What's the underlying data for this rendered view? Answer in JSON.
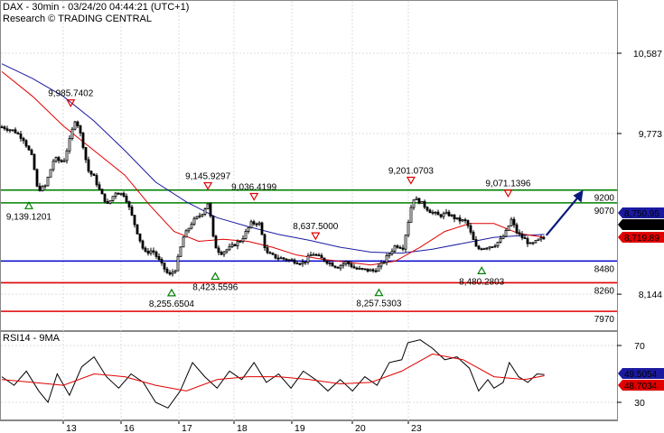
{
  "header": {
    "line1": "DAX - 30min - 03/24/20 04:44:21 (UTC+1)",
    "line2": "Research © TRADING CENTRAL"
  },
  "colors": {
    "price": "#000000",
    "ma_fast": "#e00000",
    "ma_slow": "#1a1aa0",
    "support_resistance": "#008000",
    "pivot": "#0000cc",
    "level_red": "#e00000",
    "arrow": "#0a1a7a",
    "marker_green": "#008000",
    "marker_red": "#e00000",
    "rsi": "#000000",
    "rsi_ma": "#e00000",
    "grid": "#dcdcdc"
  },
  "chart_data": [
    {
      "type": "candlestick",
      "title": "DAX - 30min - 03/24/20 04:44:21 (UTC+1)",
      "x_tick_labels": [
        "13",
        "16",
        "17",
        "18",
        "19",
        "20",
        "23"
      ],
      "y_axis_tick_labels": [
        "10,587",
        "9,773",
        "8,144"
      ],
      "ylim": [
        7850,
        11000
      ],
      "horizontal_levels": [
        {
          "value": 9200,
          "label": "9200",
          "color": "green"
        },
        {
          "value": 9070,
          "label": "9070",
          "color": "green"
        },
        {
          "value": 8480,
          "label": "8480",
          "color": "blue"
        },
        {
          "value": 8260,
          "label": "8260",
          "color": "red"
        },
        {
          "value": 7970,
          "label": "7970",
          "color": "red"
        }
      ],
      "price_tags": [
        {
          "value": 8750.95,
          "label": "8,750.95",
          "style": "blue"
        },
        {
          "value": 8741.15,
          "label": "8,741.15",
          "style": "black"
        },
        {
          "value": 8719.89,
          "label": "8,719.89",
          "style": "red"
        }
      ],
      "annotations": [
        {
          "label": "9,985.7402",
          "kind": "high",
          "x": 0.112,
          "value": 9985.74
        },
        {
          "label": "9,139.1201",
          "kind": "low",
          "x": 0.044,
          "value": 9139.12
        },
        {
          "label": "9,145.9297",
          "kind": "high",
          "x": 0.335,
          "value": 9145.93
        },
        {
          "label": "9,036.4199",
          "kind": "high",
          "x": 0.41,
          "value": 9036.42
        },
        {
          "label": "8,423.5596",
          "kind": "low",
          "x": 0.347,
          "value": 8423.56
        },
        {
          "label": "8,255.6504",
          "kind": "low",
          "x": 0.276,
          "value": 8255.65
        },
        {
          "label": "8,637.5000",
          "kind": "high",
          "x": 0.51,
          "value": 8637.5
        },
        {
          "label": "9,201.0703",
          "kind": "high",
          "x": 0.665,
          "value": 9201.07
        },
        {
          "label": "8,257.5303",
          "kind": "low",
          "x": 0.613,
          "value": 8257.53
        },
        {
          "label": "9,071.1396",
          "kind": "high",
          "x": 0.823,
          "value": 9071.14
        },
        {
          "label": "8,480.2803",
          "kind": "low",
          "x": 0.78,
          "value": 8480.28
        }
      ],
      "close_points": [
        [
          0,
          9840
        ],
        [
          0.02,
          9800
        ],
        [
          0.035,
          9720
        ],
        [
          0.05,
          9520
        ],
        [
          0.058,
          9200
        ],
        [
          0.07,
          9230
        ],
        [
          0.085,
          9520
        ],
        [
          0.1,
          9480
        ],
        [
          0.11,
          9700
        ],
        [
          0.12,
          9935
        ],
        [
          0.13,
          9720
        ],
        [
          0.14,
          9400
        ],
        [
          0.15,
          9330
        ],
        [
          0.16,
          9180
        ],
        [
          0.172,
          9050
        ],
        [
          0.185,
          9180
        ],
        [
          0.2,
          9150
        ],
        [
          0.222,
          8740
        ],
        [
          0.232,
          8560
        ],
        [
          0.245,
          8590
        ],
        [
          0.26,
          8440
        ],
        [
          0.272,
          8330
        ],
        [
          0.282,
          8400
        ],
        [
          0.295,
          8720
        ],
        [
          0.31,
          8880
        ],
        [
          0.325,
          8960
        ],
        [
          0.336,
          9080
        ],
        [
          0.345,
          8650
        ],
        [
          0.355,
          8560
        ],
        [
          0.37,
          8610
        ],
        [
          0.39,
          8700
        ],
        [
          0.405,
          8860
        ],
        [
          0.418,
          8870
        ],
        [
          0.43,
          8560
        ],
        [
          0.445,
          8520
        ],
        [
          0.46,
          8500
        ],
        [
          0.475,
          8480
        ],
        [
          0.49,
          8460
        ],
        [
          0.505,
          8560
        ],
        [
          0.515,
          8520
        ],
        [
          0.53,
          8470
        ],
        [
          0.545,
          8420
        ],
        [
          0.56,
          8470
        ],
        [
          0.575,
          8400
        ],
        [
          0.59,
          8390
        ],
        [
          0.605,
          8380
        ],
        [
          0.618,
          8450
        ],
        [
          0.628,
          8540
        ],
        [
          0.64,
          8640
        ],
        [
          0.652,
          8620
        ],
        [
          0.662,
          8920
        ],
        [
          0.668,
          9120
        ],
        [
          0.68,
          9080
        ],
        [
          0.695,
          8990
        ],
        [
          0.71,
          8940
        ],
        [
          0.725,
          8960
        ],
        [
          0.74,
          8900
        ],
        [
          0.755,
          8880
        ],
        [
          0.772,
          8600
        ],
        [
          0.785,
          8620
        ],
        [
          0.8,
          8640
        ],
        [
          0.812,
          8700
        ],
        [
          0.82,
          8780
        ],
        [
          0.828,
          8900
        ],
        [
          0.838,
          8760
        ],
        [
          0.85,
          8700
        ],
        [
          0.86,
          8640
        ],
        [
          0.872,
          8690
        ],
        [
          0.882,
          8720
        ]
      ],
      "ma_fast_points": [
        [
          0,
          10400
        ],
        [
          0.05,
          10150
        ],
        [
          0.1,
          9850
        ],
        [
          0.15,
          9600
        ],
        [
          0.2,
          9350
        ],
        [
          0.24,
          9050
        ],
        [
          0.28,
          8780
        ],
        [
          0.32,
          8680
        ],
        [
          0.36,
          8700
        ],
        [
          0.4,
          8680
        ],
        [
          0.44,
          8620
        ],
        [
          0.48,
          8540
        ],
        [
          0.52,
          8500
        ],
        [
          0.56,
          8470
        ],
        [
          0.6,
          8440
        ],
        [
          0.64,
          8480
        ],
        [
          0.68,
          8620
        ],
        [
          0.72,
          8780
        ],
        [
          0.76,
          8860
        ],
        [
          0.8,
          8860
        ],
        [
          0.84,
          8760
        ],
        [
          0.882,
          8720
        ]
      ],
      "ma_slow_points": [
        [
          0,
          10480
        ],
        [
          0.05,
          10330
        ],
        [
          0.1,
          10150
        ],
        [
          0.15,
          9900
        ],
        [
          0.2,
          9600
        ],
        [
          0.25,
          9280
        ],
        [
          0.3,
          9080
        ],
        [
          0.35,
          8920
        ],
        [
          0.4,
          8830
        ],
        [
          0.45,
          8750
        ],
        [
          0.5,
          8690
        ],
        [
          0.55,
          8620
        ],
        [
          0.6,
          8570
        ],
        [
          0.65,
          8560
        ],
        [
          0.7,
          8600
        ],
        [
          0.75,
          8660
        ],
        [
          0.8,
          8720
        ],
        [
          0.85,
          8740
        ],
        [
          0.882,
          8750
        ]
      ],
      "projection_arrow": {
        "from": [
          0.885,
          8740
        ],
        "to": [
          0.945,
          9200
        ]
      }
    },
    {
      "type": "line",
      "title": "RSI14 - 9MA",
      "series": [
        {
          "name": "RSI14",
          "color": "black"
        },
        {
          "name": "9MA",
          "color": "red"
        }
      ],
      "y_axis_tick_labels": [
        "70",
        "30"
      ],
      "ylim": [
        15,
        85
      ],
      "value_tags": [
        {
          "value": 49.5054,
          "label": "49.5054",
          "style": "blue"
        },
        {
          "value": 48.7034,
          "label": "48.7034",
          "style": "red"
        }
      ],
      "rsi_points": [
        [
          0,
          48
        ],
        [
          0.02,
          42
        ],
        [
          0.04,
          52
        ],
        [
          0.06,
          38
        ],
        [
          0.075,
          30
        ],
        [
          0.09,
          50
        ],
        [
          0.11,
          35
        ],
        [
          0.13,
          55
        ],
        [
          0.15,
          62
        ],
        [
          0.17,
          48
        ],
        [
          0.19,
          40
        ],
        [
          0.21,
          50
        ],
        [
          0.23,
          44
        ],
        [
          0.25,
          30
        ],
        [
          0.27,
          26
        ],
        [
          0.29,
          38
        ],
        [
          0.31,
          58
        ],
        [
          0.33,
          48
        ],
        [
          0.35,
          40
        ],
        [
          0.37,
          52
        ],
        [
          0.39,
          46
        ],
        [
          0.41,
          58
        ],
        [
          0.43,
          44
        ],
        [
          0.45,
          50
        ],
        [
          0.47,
          40
        ],
        [
          0.49,
          52
        ],
        [
          0.51,
          46
        ],
        [
          0.53,
          38
        ],
        [
          0.55,
          46
        ],
        [
          0.57,
          38
        ],
        [
          0.59,
          48
        ],
        [
          0.61,
          42
        ],
        [
          0.63,
          58
        ],
        [
          0.65,
          60
        ],
        [
          0.66,
          72
        ],
        [
          0.68,
          74
        ],
        [
          0.7,
          68
        ],
        [
          0.72,
          60
        ],
        [
          0.74,
          62
        ],
        [
          0.76,
          54
        ],
        [
          0.775,
          38
        ],
        [
          0.79,
          46
        ],
        [
          0.8,
          40
        ],
        [
          0.815,
          44
        ],
        [
          0.825,
          58
        ],
        [
          0.84,
          48
        ],
        [
          0.855,
          44
        ],
        [
          0.87,
          50
        ],
        [
          0.882,
          49.5
        ]
      ],
      "rsi_ma_points": [
        [
          0,
          46
        ],
        [
          0.05,
          44
        ],
        [
          0.1,
          42
        ],
        [
          0.15,
          50
        ],
        [
          0.2,
          48
        ],
        [
          0.25,
          42
        ],
        [
          0.3,
          38
        ],
        [
          0.35,
          46
        ],
        [
          0.4,
          48
        ],
        [
          0.45,
          48
        ],
        [
          0.5,
          46
        ],
        [
          0.55,
          43
        ],
        [
          0.6,
          44
        ],
        [
          0.65,
          52
        ],
        [
          0.7,
          64
        ],
        [
          0.75,
          60
        ],
        [
          0.8,
          48
        ],
        [
          0.85,
          46
        ],
        [
          0.882,
          48.7
        ]
      ]
    }
  ]
}
